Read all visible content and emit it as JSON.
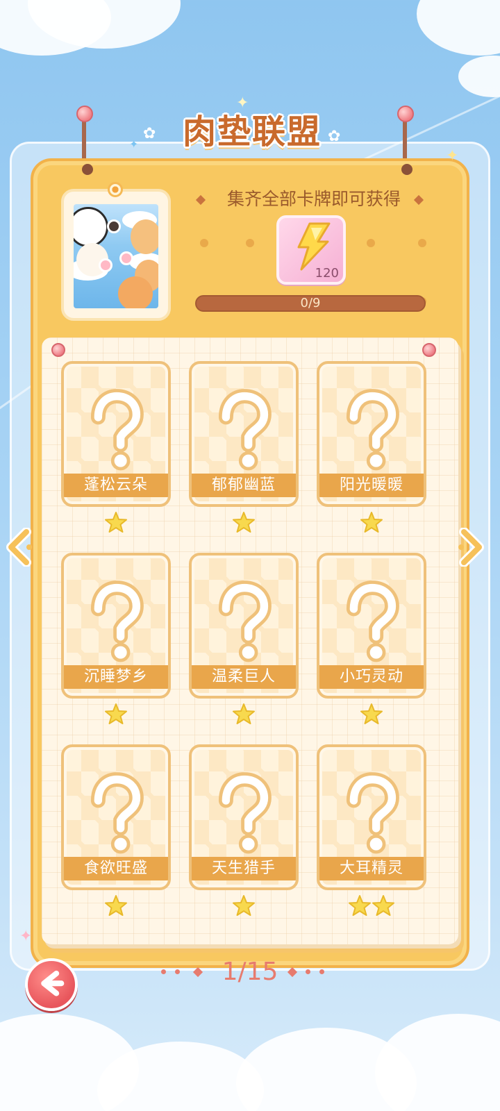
{
  "title": "肉垫联盟",
  "reward": {
    "caption": "集齐全部卡牌即可获得",
    "item_icon": "lightning-bolt-icon",
    "item_count": "120",
    "progress_text": "0/9",
    "progress_fraction": 0
  },
  "cards": [
    {
      "name": "蓬松云朵",
      "stars": 1,
      "locked_icon": "question-mark-icon"
    },
    {
      "name": "郁郁幽蓝",
      "stars": 1,
      "locked_icon": "question-mark-icon"
    },
    {
      "name": "阳光暖暖",
      "stars": 1,
      "locked_icon": "question-mark-icon"
    },
    {
      "name": "沉睡梦乡",
      "stars": 1,
      "locked_icon": "question-mark-icon"
    },
    {
      "name": "温柔巨人",
      "stars": 1,
      "locked_icon": "question-mark-icon"
    },
    {
      "name": "小巧灵动",
      "stars": 1,
      "locked_icon": "question-mark-icon"
    },
    {
      "name": "食欲旺盛",
      "stars": 1,
      "locked_icon": "question-mark-icon"
    },
    {
      "name": "天生猎手",
      "stars": 1,
      "locked_icon": "question-mark-icon"
    },
    {
      "name": "大耳精灵",
      "stars": 2,
      "locked_icon": "question-mark-icon"
    }
  ],
  "pager": {
    "text": "1/15"
  },
  "colors": {
    "board": "#f8c860",
    "card_label": "#e9a64b",
    "title": "#c96a2c",
    "back_button": "#e8565c",
    "star": "#f8d94e"
  }
}
